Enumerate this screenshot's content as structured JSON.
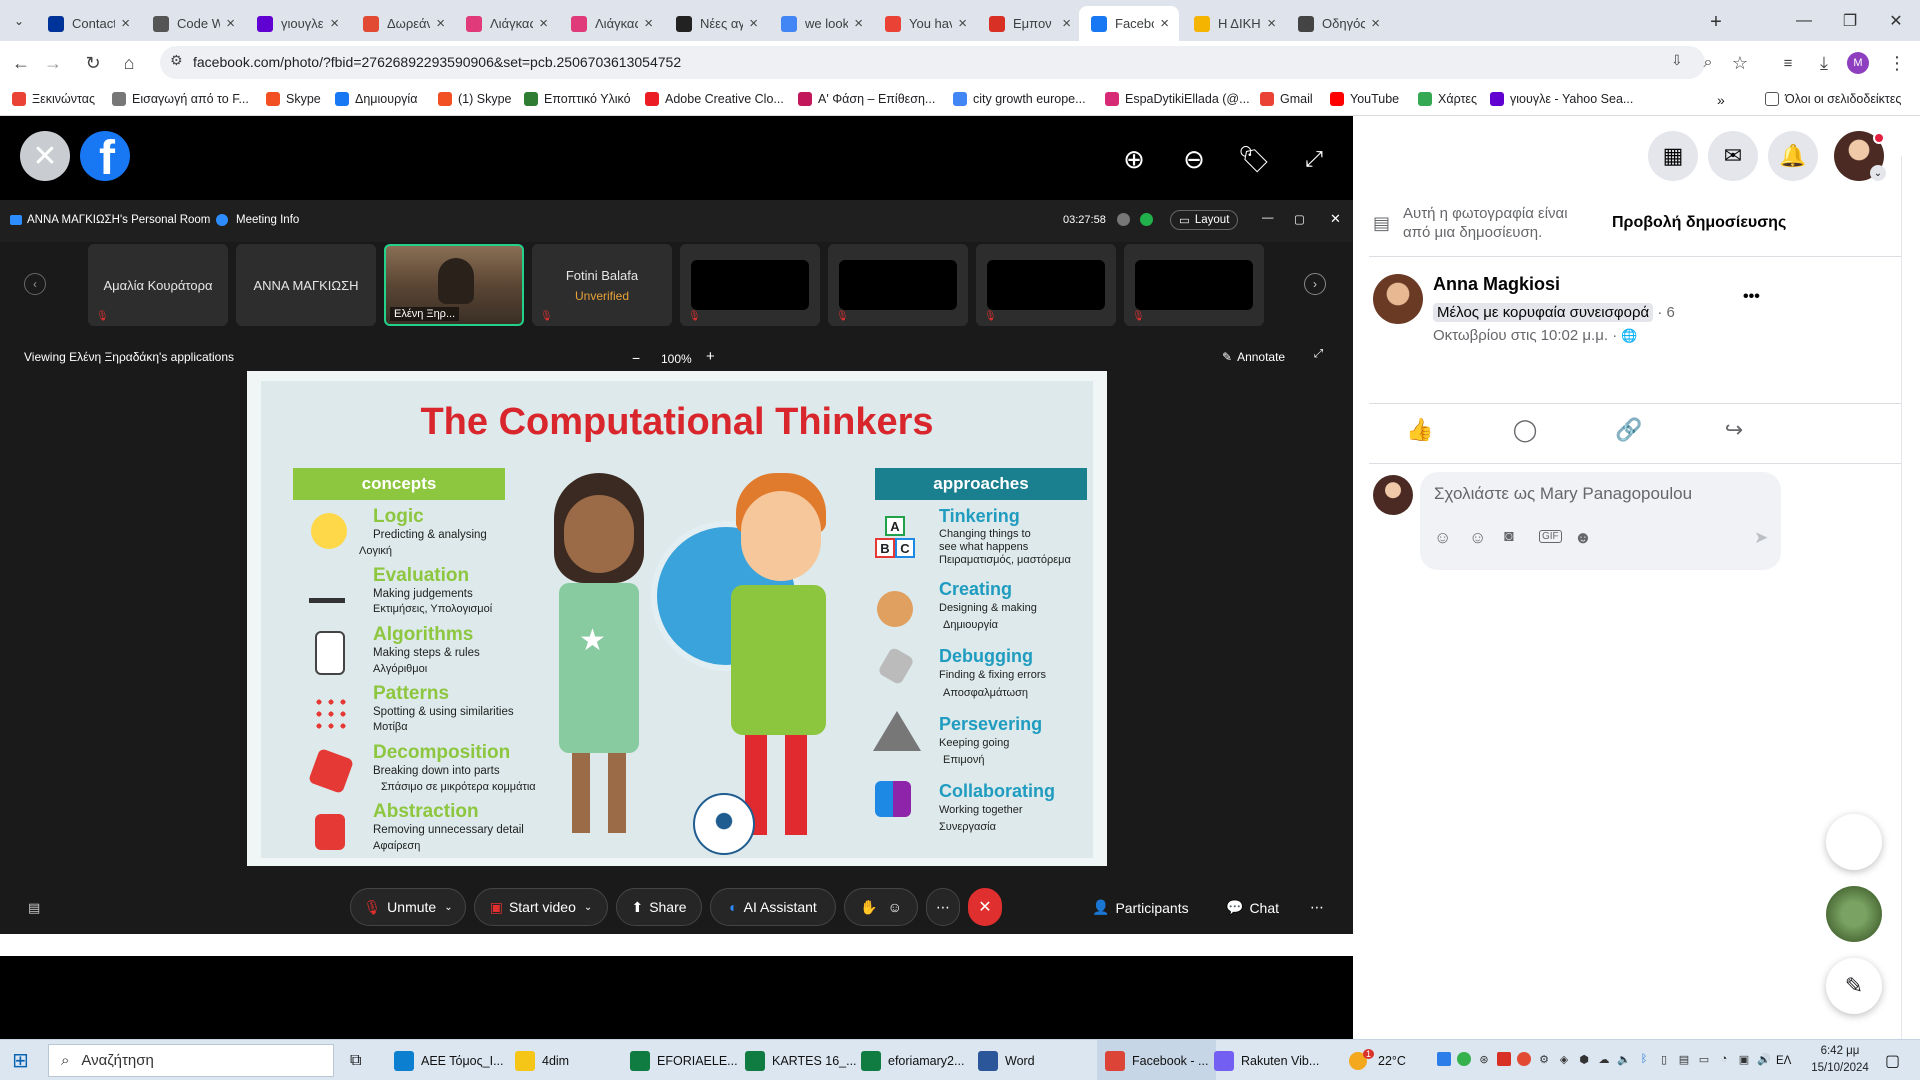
{
  "browser": {
    "tabs": [
      {
        "label": "Contacts |",
        "icon": "eu-flag-icon",
        "color": "#003399"
      },
      {
        "label": "Code Wee",
        "icon": "codeweek-icon",
        "color": "#555555"
      },
      {
        "label": "γιουγλε - Y",
        "icon": "yahoo-icon",
        "color": "#6001d2"
      },
      {
        "label": "Δωρεάν ε",
        "icon": "app-icon",
        "color": "#e24a33"
      },
      {
        "label": "Λιάγκας: ",
        "icon": "app-icon",
        "color": "#e03a7a"
      },
      {
        "label": "Λιάγκας: ",
        "icon": "app-icon",
        "color": "#e03a7a"
      },
      {
        "label": "Νέες αγωγ",
        "icon": "quora-icon",
        "color": "#222222"
      },
      {
        "label": "we look fo",
        "icon": "google-icon",
        "color": "#4285f4"
      },
      {
        "label": "You have b",
        "icon": "gmail-icon",
        "color": "#ea4335"
      },
      {
        "label": "Εμπον",
        "icon": "chart-icon",
        "color": "#d93025"
      },
      {
        "label": "Facebook",
        "icon": "facebook-icon",
        "color": "#1877f2"
      },
      {
        "label": "Η ΔΙΚΗ Μ",
        "icon": "app-icon",
        "color": "#f4b400"
      },
      {
        "label": "Οδηγός γι",
        "icon": "doc-icon",
        "color": "#444444"
      }
    ],
    "url": "facebook.com/photo/?fbid=27626892293590906&set=pcb.2506703613054752",
    "bookmarks": [
      {
        "label": "Ξεκινώντας",
        "color": "#ea4335"
      },
      {
        "label": "Εισαγωγή από το F...",
        "color": "#777777"
      },
      {
        "label": "Skype",
        "color": "#f25022"
      },
      {
        "label": "Δημιουργία",
        "color": "#1877f2"
      },
      {
        "label": "(1) Skype",
        "color": "#f25022"
      },
      {
        "label": "Εποπτικό Υλικό",
        "color": "#2e7d32"
      },
      {
        "label": "Adobe Creative Clo...",
        "color": "#ec1c24"
      },
      {
        "label": "Α' Φάση – Επίθεση...",
        "color": "#c2185b"
      },
      {
        "label": "city growth europe...",
        "color": "#4285f4"
      },
      {
        "label": "EspaDytikiEllada (@...",
        "color": "#d62976"
      },
      {
        "label": "Gmail",
        "color": "#ea4335"
      },
      {
        "label": "YouTube",
        "color": "#ff0000"
      },
      {
        "label": "Χάρτες",
        "color": "#34a853"
      },
      {
        "label": "γιουγλε - Yahoo Sea...",
        "color": "#6001d2"
      }
    ],
    "all_bookmarks": "Όλοι οι σελιδοδείκτες",
    "profile_initial": "M"
  },
  "zoom": {
    "room_title": "ΑΝΝΑ ΜΑΓΚΙΩΣΗ's Personal Room",
    "meeting_info": "Meeting Info",
    "timer": "03:27:58",
    "layout_label": "Layout",
    "participants": [
      {
        "name": "Αμαλία Κουράτορα"
      },
      {
        "name": "ΑΝΝΑ ΜΑΓΚΙΩΣΗ"
      },
      {
        "name": "Ελένη Ξηρ..."
      },
      {
        "name": "Fotini Balafa",
        "status": "Unverified"
      }
    ],
    "viewing": "Viewing Ελένη Ξηραδάκη's applications",
    "zoom_level": "100%",
    "annotate": "Annotate",
    "toolbar": {
      "unmute": "Unmute",
      "start_video": "Start video",
      "share": "Share",
      "ai": "AI Assistant",
      "participants": "Participants",
      "chat": "Chat"
    }
  },
  "slide": {
    "title": "The Computational Thinkers",
    "concepts_header": "concepts",
    "approaches_header": "approaches",
    "concepts": [
      {
        "title": "Logic",
        "desc": "Predicting & analysing",
        "greek": "Λογική"
      },
      {
        "title": "Evaluation",
        "desc": "Making judgements",
        "greek": "Εκτιμήσεις, Υπολογισμοί"
      },
      {
        "title": "Algorithms",
        "desc": "Making steps & rules",
        "greek": "Αλγόριθμοι"
      },
      {
        "title": "Patterns",
        "desc": "Spotting & using similarities",
        "greek": "Μοτίβα"
      },
      {
        "title": "Decomposition",
        "desc": "Breaking down into parts",
        "greek": "Σπάσιμο σε μικρότερα κομμάτια"
      },
      {
        "title": "Abstraction",
        "desc": "Removing unnecessary detail",
        "greek": "Αφαίρεση"
      }
    ],
    "approaches": [
      {
        "title": "Tinkering",
        "desc": "Changing things to\nsee what happens",
        "greek": "Πειραματισμός, μαστόρεμα"
      },
      {
        "title": "Creating",
        "desc": "Designing & making",
        "greek": "Δημιουργία"
      },
      {
        "title": "Debugging",
        "desc": "Finding & fixing errors",
        "greek": "Αποσφαλμάτωση"
      },
      {
        "title": "Persevering",
        "desc": "Keeping going",
        "greek": "Επιμονή"
      },
      {
        "title": "Collaborating",
        "desc": "Working together",
        "greek": "Συνεργασία"
      }
    ],
    "blocks": [
      "A",
      "B",
      "C"
    ]
  },
  "facebook": {
    "post_notice": "Αυτή η φωτογραφία είναι από μια δημοσίευση.",
    "view_post": "Προβολή δημοσίευσης",
    "author": "Anna Magkiosi",
    "badge": "Μέλος με κορυφαία συνεισφορά",
    "date_prefix": " · 6",
    "date": "Οκτωβρίου στις 10:02 μ.μ. ·",
    "more": "•••",
    "comment_placeholder": "Σχολιάστε ως Mary Panagopoulou"
  },
  "taskbar": {
    "search": "Αναζήτηση",
    "items": [
      {
        "label": "ΑΕΕ Τόμος_Ι...",
        "color": "#0c7fd1"
      },
      {
        "label": "4dim",
        "color": "#f5c518"
      },
      {
        "label": "EFORIAELE...",
        "color": "#107c41"
      },
      {
        "label": "KARTES 16_...",
        "color": "#107c41"
      },
      {
        "label": "eforiamary2...",
        "color": "#107c41"
      },
      {
        "label": "Word",
        "color": "#2b579a"
      },
      {
        "label": "Facebook - ...",
        "color": "#db4437"
      },
      {
        "label": "Rakuten Vib...",
        "color": "#7360f2"
      }
    ],
    "weather": "22°C",
    "weather_badge": "1",
    "lang": "ΕΛ",
    "time": "6:42 μμ",
    "date": "15/10/2024"
  }
}
